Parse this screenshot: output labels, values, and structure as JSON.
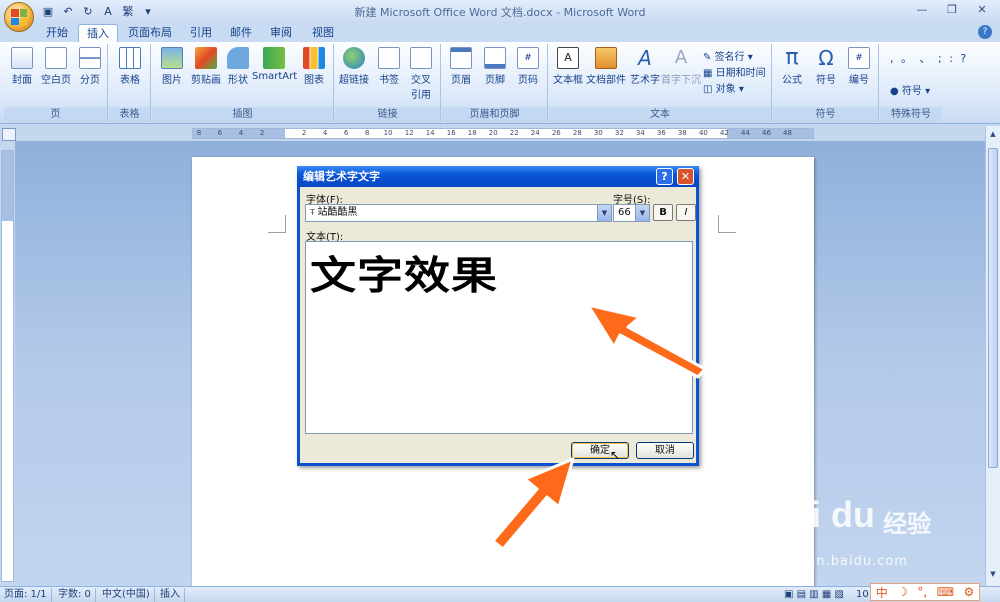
{
  "app": {
    "title": "新建 Microsoft Office Word 文档.docx - Microsoft Word"
  },
  "quick_access": [
    "save-icon",
    "undo-icon",
    "redo-icon",
    "font-color-icon",
    "format-painter-icon",
    "customize-icon"
  ],
  "tabs": [
    {
      "label": "开始",
      "active": false
    },
    {
      "label": "插入",
      "active": true
    },
    {
      "label": "页面布局",
      "active": false
    },
    {
      "label": "引用",
      "active": false
    },
    {
      "label": "邮件",
      "active": false
    },
    {
      "label": "审阅",
      "active": false
    },
    {
      "label": "视图",
      "active": false
    }
  ],
  "ribbon": {
    "groups": {
      "pages": "页",
      "tables": "表格",
      "illustrations": "插图",
      "links": "链接",
      "header_footer": "页眉和页脚",
      "text": "文本",
      "symbols": "符号",
      "special": "特殊符号"
    },
    "buttons": {
      "cover": "封面",
      "blank": "空白页",
      "pagebreak": "分页",
      "table": "表格",
      "picture": "图片",
      "clipart": "剪贴画",
      "shapes": "形状",
      "smartart": "SmartArt",
      "chart": "图表",
      "hyperlink": "超链接",
      "bookmark": "书签",
      "crossref": "交叉引用",
      "header": "页眉",
      "footer": "页脚",
      "pagenum": "页码",
      "textbox": "文本框",
      "quickparts": "文档部件",
      "wordart": "艺术字",
      "dropcap": "首字下沉",
      "signature": "签名行",
      "datetime": "日期和时间",
      "object": "对象",
      "equation": "公式",
      "symbol": "符号",
      "number": "编号",
      "special_symbol": "符号"
    },
    "special_chars": ", 。 、 ; : ?"
  },
  "ruler": {
    "labels": [
      "8",
      "6",
      "4",
      "2",
      "",
      "2",
      "4",
      "6",
      "8",
      "10",
      "12",
      "14",
      "16",
      "18",
      "20",
      "22",
      "24",
      "26",
      "28",
      "30",
      "32",
      "34",
      "36",
      "38",
      "40",
      "42",
      "44",
      "46",
      "48"
    ]
  },
  "dialog": {
    "title": "编辑艺术字文字",
    "font_label": "字体(F):",
    "font_value": "站酷酷黑",
    "size_label": "字号(S):",
    "size_value": "66",
    "bold_label": "B",
    "italic_label": "I",
    "text_label": "文本(T):",
    "text_value": "文字效果",
    "ok_label": "确定",
    "cancel_label": "取消"
  },
  "status": {
    "page": "页面: 1/1",
    "words": "字数: 0",
    "language": "中文(中国)",
    "mode": "插入",
    "zoom_partial": "10"
  },
  "ime": [
    "中",
    "☽",
    "°,",
    "⌨",
    "⚙"
  ],
  "watermark": {
    "brand": "Bai du",
    "cn": "经验",
    "url": "jingyan.baidu.com"
  },
  "colors": {
    "ribbon_text": "#15428b",
    "dialog_title": "#0a56d8",
    "arrow": "#ff6a1a"
  }
}
